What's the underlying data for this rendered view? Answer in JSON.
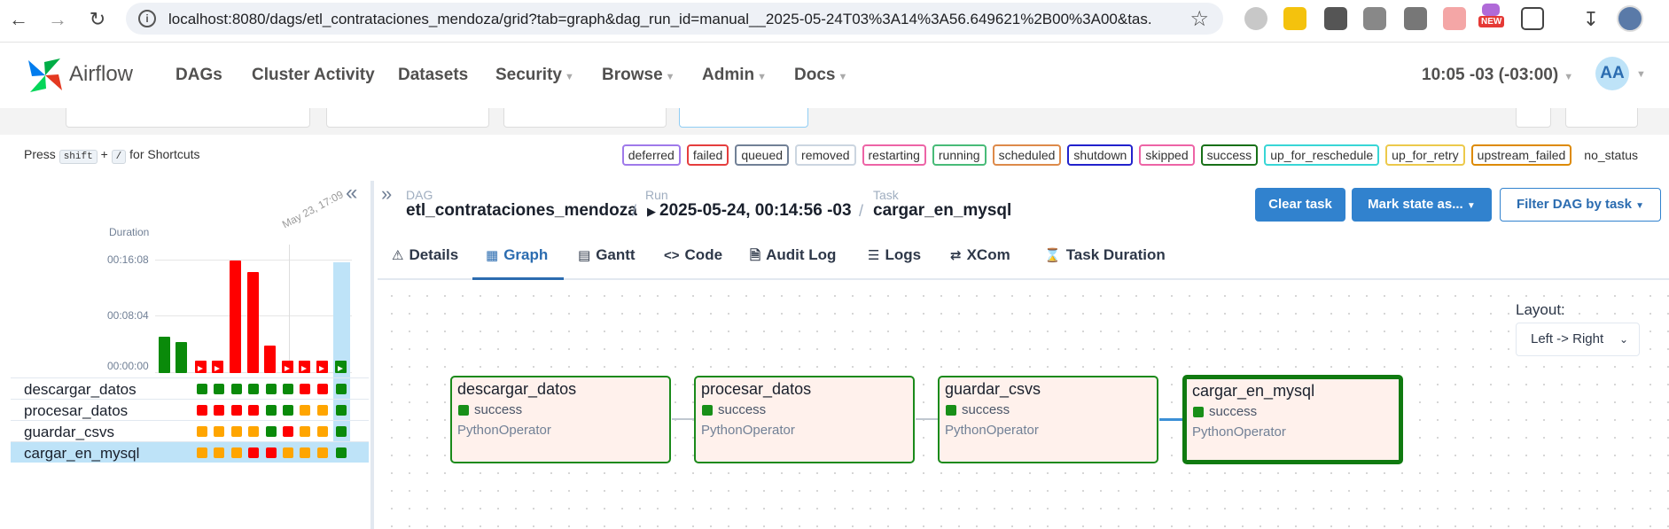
{
  "browser": {
    "url": "localhost:8080/dags/etl_contrataciones_mendoza/grid?tab=graph&dag_run_id=manual__2025-05-24T03%3A14%3A56.649621%2B00%3A00&tas...",
    "new_badge": "NEW"
  },
  "nav": {
    "brand": "Airflow",
    "items": [
      "DAGs",
      "Cluster Activity",
      "Datasets",
      "Security",
      "Browse",
      "Admin",
      "Docs"
    ],
    "clock": "10:05 -03 (-03:00)",
    "avatar": "AA"
  },
  "shortcuts": {
    "prefix": "Press",
    "key1": "shift",
    "plus": "+",
    "key2": "/",
    "suffix": "for Shortcuts"
  },
  "legend": [
    {
      "label": "deferred",
      "color": "#9f7aea"
    },
    {
      "label": "failed",
      "color": "#e53e3e"
    },
    {
      "label": "queued",
      "color": "#718096"
    },
    {
      "label": "removed",
      "color": "#cbd5e0"
    },
    {
      "label": "restarting",
      "color": "#ed64a6"
    },
    {
      "label": "running",
      "color": "#48bb78"
    },
    {
      "label": "scheduled",
      "color": "#dd8a4a"
    },
    {
      "label": "shutdown",
      "color": "#2222cc"
    },
    {
      "label": "skipped",
      "color": "#ed64a6"
    },
    {
      "label": "success",
      "color": "#187018"
    },
    {
      "label": "up_for_reschedule",
      "color": "#38d6d6"
    },
    {
      "label": "up_for_retry",
      "color": "#ecc94b"
    },
    {
      "label": "upstream_failed",
      "color": "#dd8a00"
    },
    {
      "label": "no_status",
      "color": "transparent"
    }
  ],
  "grid": {
    "duration_label": "Duration",
    "y_ticks": [
      "00:16:08",
      "00:08:04",
      "00:00:00"
    ],
    "date_tick": "May 23, 17:09",
    "runs": [
      {
        "state": "success",
        "minutes": 5.2
      },
      {
        "state": "success",
        "minutes": 4.4
      },
      {
        "state": "failed",
        "minutes": 1.2
      },
      {
        "state": "failed",
        "minutes": 1.2
      },
      {
        "state": "failed",
        "minutes": 16.1
      },
      {
        "state": "failed",
        "minutes": 14.5
      },
      {
        "state": "failed",
        "minutes": 4.0
      },
      {
        "state": "failed",
        "minutes": 1.2
      },
      {
        "state": "failed",
        "minutes": 1.2
      },
      {
        "state": "failed",
        "minutes": 1.2
      },
      {
        "state": "success",
        "minutes": 1.2
      }
    ],
    "tasks": [
      {
        "name": "descargar_datos",
        "states": [
          "success",
          "success",
          "success",
          "success",
          "success",
          "success",
          "failed",
          "failed",
          "success"
        ]
      },
      {
        "name": "procesar_datos",
        "states": [
          "failed",
          "failed",
          "failed",
          "failed",
          "success",
          "success",
          "upstream_failed",
          "upstream_failed",
          "success"
        ]
      },
      {
        "name": "guardar_csvs",
        "states": [
          "upstream_failed",
          "upstream_failed",
          "upstream_failed",
          "upstream_failed",
          "success",
          "failed",
          "upstream_failed",
          "upstream_failed",
          "success"
        ]
      },
      {
        "name": "cargar_en_mysql",
        "states": [
          "upstream_failed",
          "upstream_failed",
          "upstream_failed",
          "failed",
          "failed",
          "upstream_failed",
          "upstream_failed",
          "upstream_failed",
          "success"
        ]
      }
    ]
  },
  "breadcrumb": {
    "dag_label": "DAG",
    "dag": "etl_contrataciones_mendoza",
    "run_label": "Run",
    "run": "2025-05-24, 00:14:56 -03",
    "task_label": "Task",
    "task": "cargar_en_mysql",
    "sep": "/"
  },
  "buttons": {
    "clear": "Clear task",
    "mark": "Mark state as...",
    "filter": "Filter DAG by task"
  },
  "tabs": [
    "Details",
    "Graph",
    "Gantt",
    "Code",
    "Audit Log",
    "Logs",
    "XCom",
    "Task Duration"
  ],
  "layout": {
    "label": "Layout:",
    "value": "Left -> Right"
  },
  "nodes": [
    {
      "name": "descargar_datos",
      "state": "success",
      "operator": "PythonOperator"
    },
    {
      "name": "procesar_datos",
      "state": "success",
      "operator": "PythonOperator"
    },
    {
      "name": "guardar_csvs",
      "state": "success",
      "operator": "PythonOperator"
    },
    {
      "name": "cargar_en_mysql",
      "state": "success",
      "operator": "PythonOperator"
    }
  ],
  "colors": {
    "success": "#0a8a0a",
    "failed": "#ff0000",
    "upstream_failed": "#ffa500",
    "selected": "#bee3f8"
  }
}
